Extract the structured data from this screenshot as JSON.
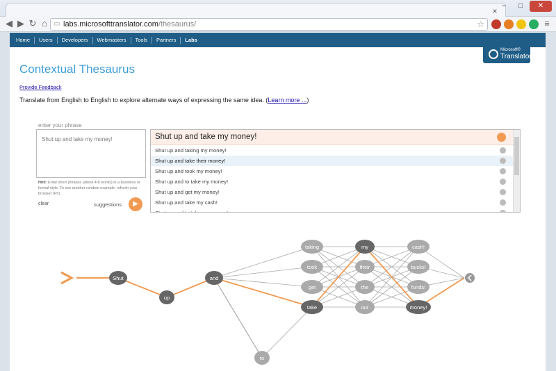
{
  "browser": {
    "url_domain": "labs.microsofttranslator.com",
    "url_path": "/thesaurus/",
    "tab_close": "×",
    "win_min": "–",
    "win_max": "□",
    "win_close": "✕"
  },
  "site_nav": {
    "items": [
      "Home",
      "Users",
      "Developers",
      "Webmasters",
      "Tools",
      "Partners",
      "Labs"
    ]
  },
  "brand": {
    "small": "Microsoft®",
    "large": "Translator"
  },
  "page": {
    "title": "Contextual Thesaurus",
    "feedback": "Provide Feedback",
    "intro": "Translate from English to English to explore alternate ways of expressing the same idea. (",
    "learn_more": "Learn more ...",
    "intro_end": ")"
  },
  "input": {
    "label": "enter your phrase",
    "value": "Shut up and take my money!",
    "hint_label": "Hint:",
    "hint": " Enter short phrases (about 4-8 words) in a business or formal style. To see another random example, refresh your browser (F5).",
    "clear": "clear",
    "suggestions": "suggestions"
  },
  "results": {
    "top": "Shut up and take my money!",
    "rows": [
      "Shut up and taking my money!",
      "Shut up and take their money!",
      "Shut up and took my money!",
      "Shut up and to take my money!",
      "Shut up and get my money!",
      "Shut up and take my cash!",
      "Shut up and to take my money!"
    ],
    "highlighted_index": 1
  },
  "graph": {
    "accent": "#f19a52",
    "nodes": [
      "Shut",
      "up",
      "and",
      "taking",
      "took",
      "get",
      "take",
      "to",
      "my",
      "their",
      "the",
      "our",
      "cash!",
      "bucks!",
      "funds!",
      "money!"
    ]
  }
}
